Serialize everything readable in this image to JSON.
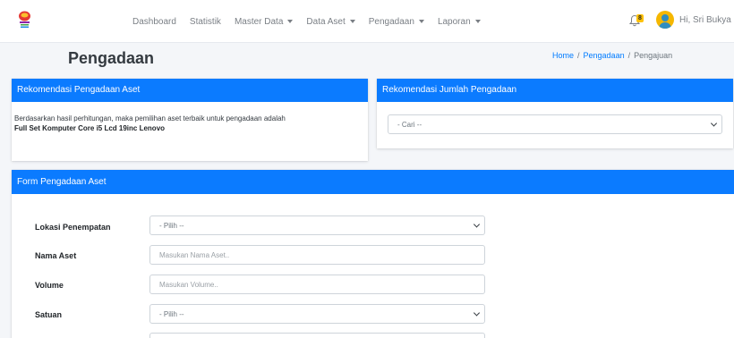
{
  "navbar": {
    "logo_icon": "app-logo-icon",
    "menu": [
      {
        "label": "Dashboard",
        "dropdown": false
      },
      {
        "label": "Statistik",
        "dropdown": false
      },
      {
        "label": "Master Data",
        "dropdown": true
      },
      {
        "label": "Data Aset",
        "dropdown": true
      },
      {
        "label": "Pengadaan",
        "dropdown": true
      },
      {
        "label": "Laporan",
        "dropdown": true
      }
    ],
    "notification_count": "8",
    "user_greeting": "Hi, Sri Bukya"
  },
  "header": {
    "title": "Pengadaan",
    "breadcrumb": [
      "Home",
      "Pengadaan",
      "Pengajuan"
    ]
  },
  "recommendation_card": {
    "title": "Rekomendasi Pengadaan Aset",
    "text": "Berdasarkan hasil perhitungan, maka pemilihan aset terbaik untuk pengadaan adalah",
    "item": "Full Set Komputer Core i5 Lcd 19inc Lenovo"
  },
  "quantity_card": {
    "title": "Rekomendasi Jumlah Pengadaan",
    "select_value": "- Cari --"
  },
  "form": {
    "title": "Form Pengadaan Aset",
    "lokasi_label": "Lokasi Penempatan",
    "lokasi_value": "- Pilih --",
    "nama_label": "Nama Aset",
    "nama_placeholder": "Masukan Nama Aset..",
    "volume_label": "Volume",
    "volume_placeholder": "Masukan Volume..",
    "satuan_label": "Satuan",
    "satuan_value": "- Pilih --"
  },
  "colors": {
    "primary": "#0b7bff",
    "link": "#007bff",
    "badge": "#ffc107"
  }
}
